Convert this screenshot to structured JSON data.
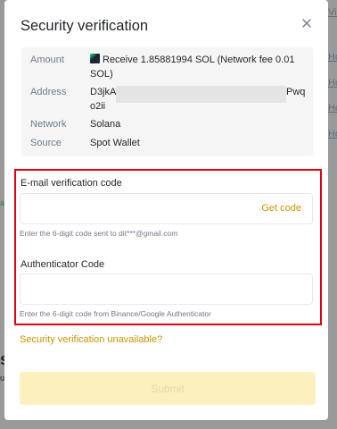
{
  "modal": {
    "title": "Security verification"
  },
  "withdrawal": {
    "amount_label": "Amount",
    "amount_value": "Receive 1.85881994 SOL (Network fee 0.01",
    "amount_value_line2": "SOL)",
    "address_label": "Address",
    "address_prefix": "D3jkA",
    "address_suffix": "Pwq",
    "address_line2": "o2ii",
    "network_label": "Network",
    "network_value": "Solana",
    "source_label": "Source",
    "source_value": "Spot Wallet"
  },
  "email_verification": {
    "label": "E-mail verification code",
    "value": "",
    "get_code_label": "Get code",
    "hint": "Enter the 6-digit code sent to dit***@gmail.com"
  },
  "authenticator": {
    "label": "Authenticator Code",
    "value": "",
    "hint": "Enter the 6-digit code from Binance/Google Authenticator"
  },
  "unavailable_link": "Security verification unavailable?",
  "submit_label": "Submit",
  "background": {
    "link_1": "Vid",
    "link_2": "Ho",
    "link_3": "Ho",
    "link_4": "Ho",
    "link_5": "Ho",
    "left_glyph_1": "a",
    "left_glyph_2": "s",
    "left_glyph_3": "u"
  },
  "colors": {
    "accent": "#c99400",
    "highlight_frame": "#e0000f",
    "submit_disabled_bg": "#fcf0bf"
  },
  "icons": {
    "close": "close-icon",
    "coin": "solana-coin-icon"
  }
}
